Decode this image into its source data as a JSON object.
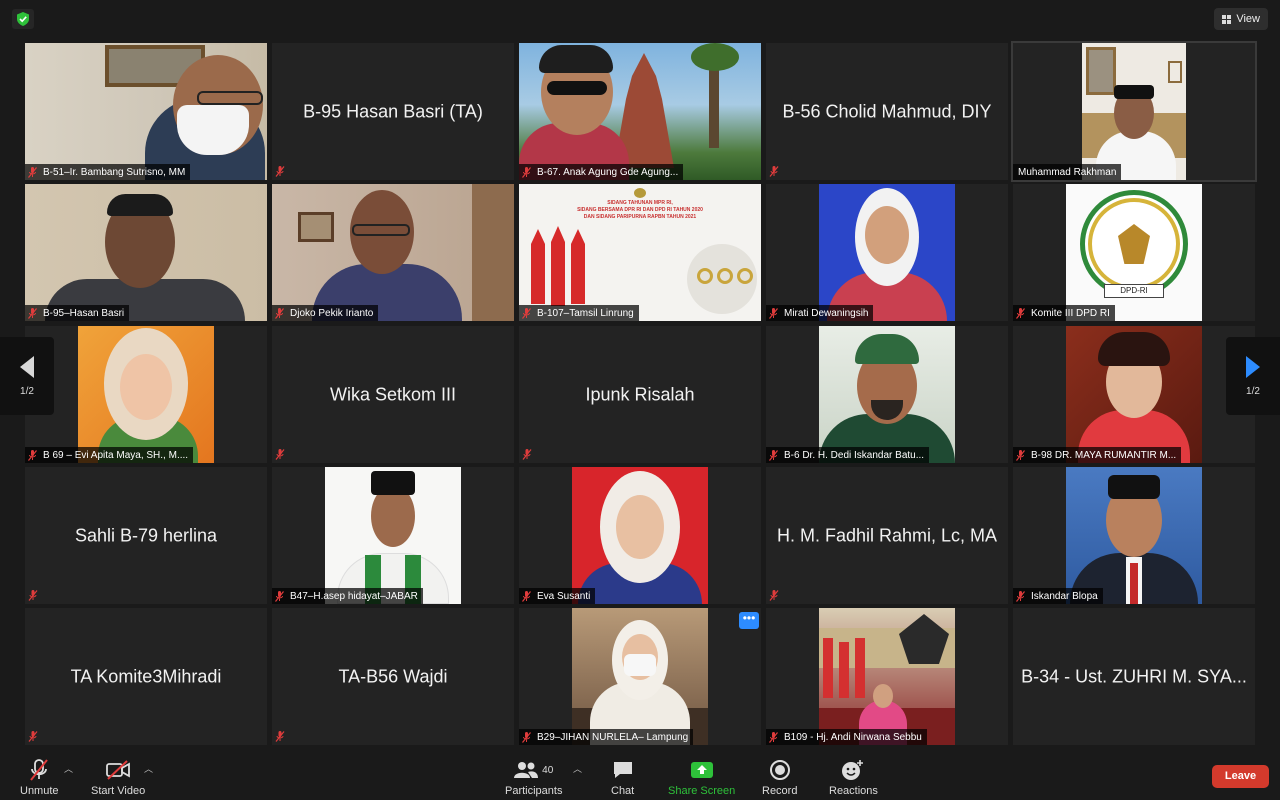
{
  "view_label": "View",
  "nav": {
    "left_page": "1/2",
    "right_page": "1/2"
  },
  "tiles": [
    {
      "name": "B-51–Ir. Bambang Sutrisno, MM"
    },
    {
      "name": "B-95 Hasan Basri (TA)"
    },
    {
      "name": "B-67. Anak Agung Gde Agung..."
    },
    {
      "name": "B-56 Cholid Mahmud, DIY"
    },
    {
      "name": "Muhammad Rakhman"
    },
    {
      "name": "B-95–Hasan Basri"
    },
    {
      "name": "Djoko Pekik  Irianto"
    },
    {
      "name": "B-107–Tamsil Linrung",
      "slide_text": [
        "SIDANG TAHUNAN MPR RI,",
        "SIDANG BERSAMA DPR RI DAN DPD RI TAHUN 2020",
        "DAN SIDANG PARIPURNA RAPBN TAHUN 2021"
      ]
    },
    {
      "name": "Mirati Dewaningsih"
    },
    {
      "name": "Komite III DPD RI",
      "logo_text": "DPD-RI"
    },
    {
      "name": "B 69 – Evi Apita Maya, SH., M...."
    },
    {
      "name": "Wika Setkom III"
    },
    {
      "name": "Ipunk Risalah"
    },
    {
      "name": "B-6 Dr. H. Dedi Iskandar Batu..."
    },
    {
      "name": "B-98 DR. MAYA RUMANTIR M..."
    },
    {
      "name": "Sahli B-79 herlina"
    },
    {
      "name": "B47–H.asep hidayat–JABAR"
    },
    {
      "name": "Eva Susanti"
    },
    {
      "name": "H. M. Fadhil Rahmi, Lc, MA"
    },
    {
      "name": "Iskandar Blopa"
    },
    {
      "name": "TA Komite3Mihradi"
    },
    {
      "name": "TA-B56 Wajdi"
    },
    {
      "name": "B29–JIHAN NURLELA– Lampung"
    },
    {
      "name": "B109 - Hj. Andi Nirwana Sebbu"
    },
    {
      "name": "B-34 - Ust. ZUHRI M. SYA..."
    }
  ],
  "toolbar": {
    "unmute": "Unmute",
    "start_video": "Start Video",
    "participants": "Participants",
    "participants_count": "40",
    "chat": "Chat",
    "share_screen": "Share Screen",
    "record": "Record",
    "reactions": "Reactions",
    "leave": "Leave"
  },
  "icons": {
    "security": "shield-check-icon",
    "view": "grid-icon",
    "muted_mic": "muted-mic-icon",
    "prev": "triangle-left-icon",
    "next": "triangle-right-icon",
    "more": "ellipsis-icon"
  },
  "colors": {
    "background": "#1a1a1a",
    "tile": "#232323",
    "muted_red": "#e03c3c",
    "share_green": "#2ec13a",
    "next_blue": "#2d8cff",
    "leave_red": "#d33a2c",
    "security_green": "#2ec13a"
  }
}
